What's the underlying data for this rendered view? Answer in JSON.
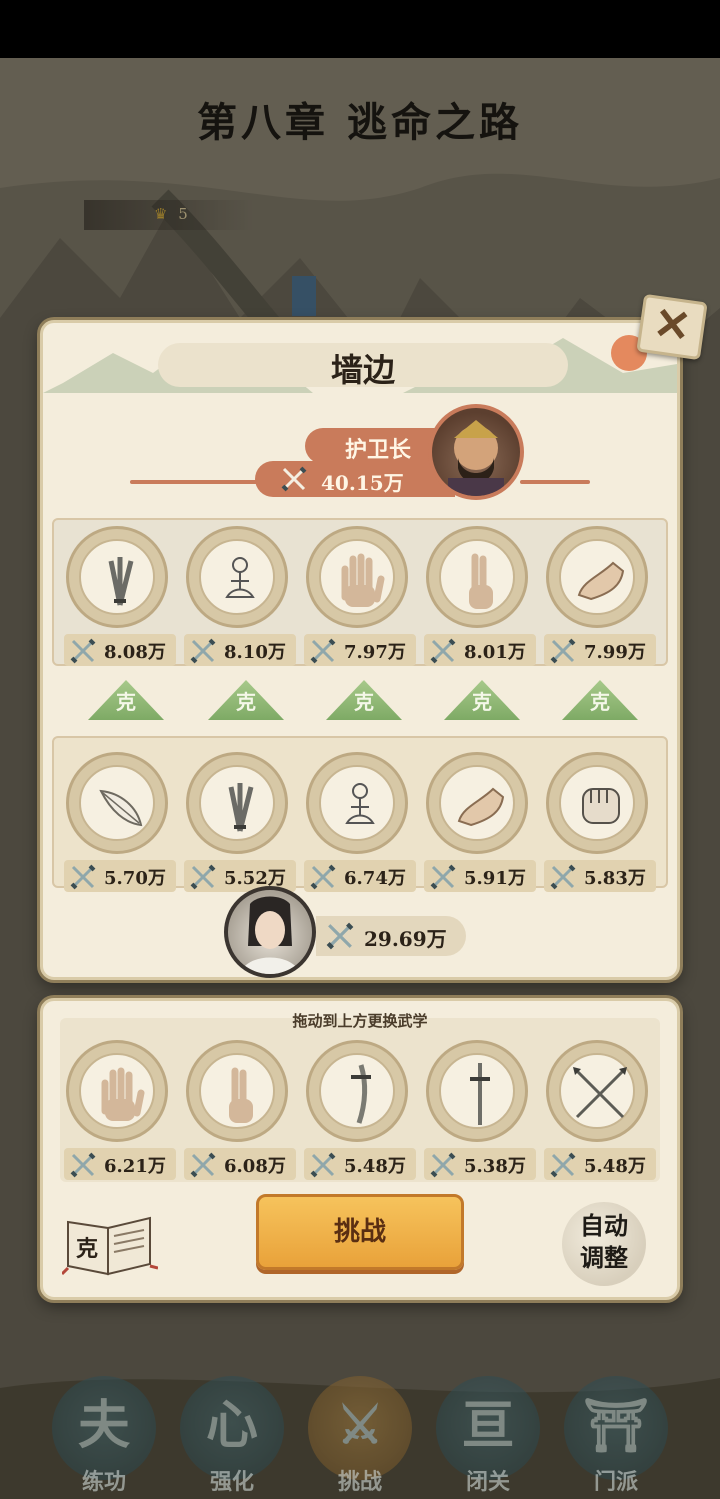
{
  "chapter": {
    "title": "第八章  逃命之路"
  },
  "map": {
    "crown_count": "5"
  },
  "stage": {
    "title": "墙边",
    "boss_name": "护卫长",
    "boss_power": "40.15万"
  },
  "enemy_skills": [
    {
      "icon": "daggers-icon",
      "power": "8.08万"
    },
    {
      "icon": "meditation-icon",
      "power": "8.10万"
    },
    {
      "icon": "palm-icon",
      "power": "7.97万"
    },
    {
      "icon": "finger-icon",
      "power": "8.01万"
    },
    {
      "icon": "shoe-icon",
      "power": "7.99万"
    }
  ],
  "counter_label": "克",
  "my_skills": [
    {
      "icon": "feather-icon",
      "power": "5.70万"
    },
    {
      "icon": "daggers-icon",
      "power": "5.52万"
    },
    {
      "icon": "meditation-icon",
      "power": "6.74万"
    },
    {
      "icon": "shoe-icon",
      "power": "5.91万"
    },
    {
      "icon": "fist-icon",
      "power": "5.83万"
    }
  ],
  "hero_power": "29.69万",
  "bag": {
    "hint": "拖动到上方更换武学",
    "skills": [
      {
        "icon": "palm-icon",
        "power": "6.21万"
      },
      {
        "icon": "finger-icon",
        "power": "6.08万"
      },
      {
        "icon": "saber-icon",
        "power": "5.48万"
      },
      {
        "icon": "sword-icon",
        "power": "5.38万"
      },
      {
        "icon": "crossed-spears-icon",
        "power": "5.48万"
      }
    ]
  },
  "buttons": {
    "challenge": "挑战",
    "counter_book": "克",
    "auto_adjust_line1": "自动",
    "auto_adjust_line2": "调整"
  },
  "nav": [
    {
      "glyph": "夫",
      "label": "练功"
    },
    {
      "glyph": "心",
      "label": "强化"
    },
    {
      "glyph": "⚔",
      "label": "挑战",
      "active": true
    },
    {
      "glyph": "亘",
      "label": "闭关"
    },
    {
      "glyph": "⛩",
      "label": "门派"
    }
  ],
  "colors": {
    "accent_orange": "#e9a23a",
    "banner_red": "#c97b5b",
    "counter_green": "#8bb572"
  }
}
